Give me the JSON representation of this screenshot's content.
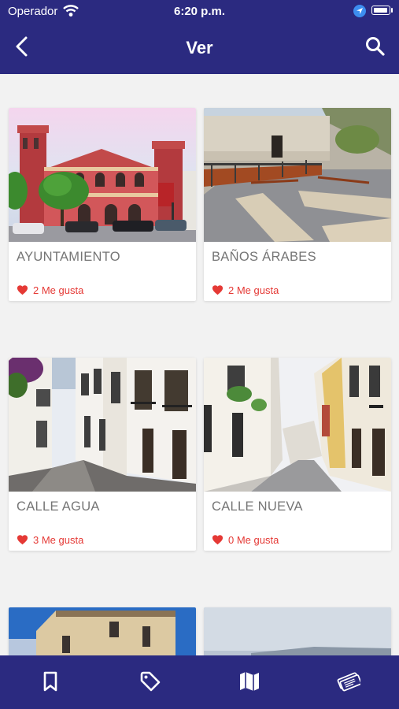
{
  "status_bar": {
    "carrier": "Operador",
    "time": "6:20 p.m."
  },
  "header": {
    "title": "Ver",
    "back_icon": "chevron-left-icon",
    "search_icon": "search-icon"
  },
  "places": [
    {
      "name": "AYUNTAMIENTO",
      "likes": "2 Me gusta"
    },
    {
      "name": "BAÑOS ÁRABES",
      "likes": "2 Me gusta"
    },
    {
      "name": "CALLE AGUA",
      "likes": "3 Me gusta"
    },
    {
      "name": "CALLE NUEVA",
      "likes": "0 Me gusta"
    }
  ],
  "tab_bar": {
    "tabs": [
      {
        "icon": "bookmark-icon"
      },
      {
        "icon": "tag-icon"
      },
      {
        "icon": "map-icon"
      },
      {
        "icon": "tickets-icon"
      }
    ]
  },
  "colors": {
    "brand": "#2b2a80",
    "like": "#e53935",
    "label": "#757575",
    "background": "#f2f2f2"
  }
}
